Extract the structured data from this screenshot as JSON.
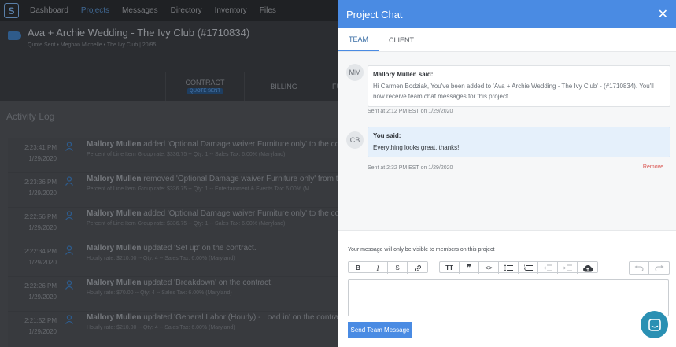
{
  "nav": {
    "logo_letter": "S",
    "items": [
      "Dashboard",
      "Projects",
      "Messages",
      "Directory",
      "Inventory",
      "Files"
    ]
  },
  "project": {
    "title": "Ava + Archie Wedding - The Ivy Club (#1710834)",
    "subtitle": "Quote Sent  •  Meghan Michelle  •  The Ivy Club | 20/95",
    "tabs": [
      {
        "label": "CONTRACT",
        "badge": "QUOTE SENT"
      },
      {
        "label": "BILLING",
        "badge": ""
      },
      {
        "label": "FUL",
        "badge": ""
      }
    ]
  },
  "activity": {
    "title": "Activity Log",
    "rows": [
      {
        "time": "2:23:41 PM",
        "date": "1/29/2020",
        "user": "Mallory Mullen",
        "action": "added 'Optional Damage waiver Furniture only' to the co",
        "detail": "Percent of Line Item Group rate: $336.75 -- Qty: 1 -- Sales Tax: 6.00% (Maryland)"
      },
      {
        "time": "2:23:36 PM",
        "date": "1/29/2020",
        "user": "Mallory Mullen",
        "action": "removed 'Optional Damage waiver Furniture only' from th",
        "detail": "Percent of Line Item Group rate: $336.75 -- Qty: 1 -- Entertainment & Events Tax: 6.00% (M"
      },
      {
        "time": "2:22:56 PM",
        "date": "1/29/2020",
        "user": "Mallory Mullen",
        "action": "added 'Optional Damage waiver Furniture only' to the co",
        "detail": "Percent of Line Item Group rate: $336.75 -- Qty: 1 -- Sales Tax: 6.00% (Maryland)"
      },
      {
        "time": "2:22:34 PM",
        "date": "1/29/2020",
        "user": "Mallory Mullen",
        "action": "updated 'Set up' on the contract.",
        "detail": "Hourly rate: $210.00 -- Qty: 4 -- Sales Tax: 6.00% (Maryland)"
      },
      {
        "time": "2:22:26 PM",
        "date": "1/29/2020",
        "user": "Mallory Mullen",
        "action": "updated 'Breakdown' on the contract.",
        "detail": "Hourly rate: $70.00 -- Qty: 4 -- Sales Tax: 6.00% (Maryland)"
      },
      {
        "time": "2:21:52 PM",
        "date": "1/29/2020",
        "user": "Mallory Mullen",
        "action": "updated 'General Labor (Hourly) - Load in' on the contra",
        "detail": "Hourly rate: $210.00 -- Qty: 4 -- Sales Tax: 6.00% (Maryland)"
      }
    ]
  },
  "chat": {
    "title": "Project Chat",
    "close_glyph": "✕",
    "tabs": [
      "TEAM",
      "CLIENT"
    ],
    "messages": [
      {
        "initials": "MM",
        "author": "Mallory Mullen said:",
        "text": "Hi Carmen Bodziak, You've been added to 'Ava + Archie Wedding - The Ivy Club' - (#1710834). You'll now receive team chat messages for this project.",
        "sent": "Sent at 2:12 PM EST on 1/29/2020"
      },
      {
        "initials": "CB",
        "author": "You said:",
        "text": "Everything looks great, thanks!",
        "sent": "Sent at 2:32 PM EST on 1/29/2020",
        "remove_label": "Remove"
      }
    ],
    "notice": "Your message will only be visible to members on this project",
    "send_label": "Send Team Message"
  },
  "colors": {
    "accent": "#4a8be3",
    "remove": "#d9534f",
    "help_button": "#2a90b3"
  }
}
